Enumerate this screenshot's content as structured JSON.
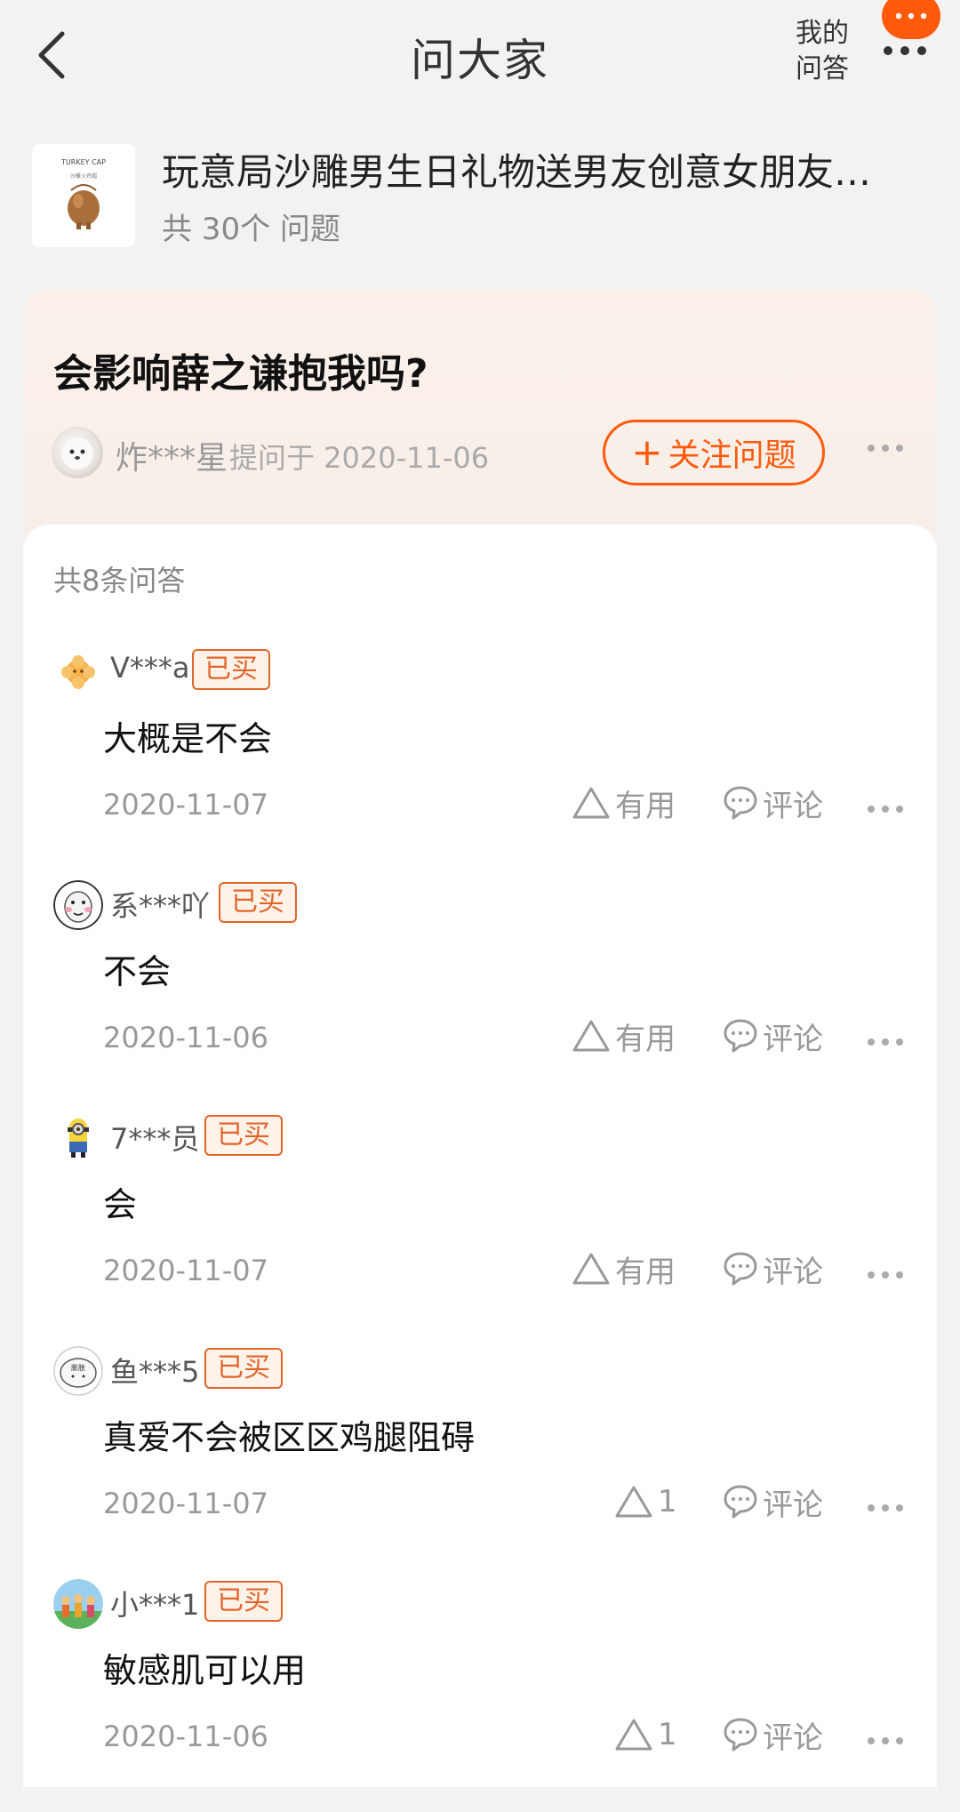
{
  "header": {
    "title": "问大家",
    "my_qa_line1": "我的",
    "my_qa_line2": "问答",
    "back_icon": "chevron-left-icon",
    "more_icon": "more-icon",
    "accent": "#ff5a0c"
  },
  "product": {
    "thumb_text": "TURKEY CAP",
    "name": "玩意局沙雕男生日礼物送男友创意女朋友…",
    "count": "共 30个 问题"
  },
  "question": {
    "text": "会影响薛之谦抱我吗?",
    "asker": "炸***星",
    "asked_at": "提问于 2020-11-06",
    "follow_label": "关注问题"
  },
  "answers_section": {
    "count_label": "共8条问答",
    "useful_label": "有用",
    "comment_label": "评论",
    "bought_label": "已买",
    "items": [
      {
        "user": "V***a",
        "text": "大概是不会",
        "date": "2020-11-07",
        "useful": "有用"
      },
      {
        "user": "系***吖",
        "text": "不会",
        "date": "2020-11-06",
        "useful": "有用"
      },
      {
        "user": "7***员",
        "text": "会",
        "date": "2020-11-07",
        "useful": "有用"
      },
      {
        "user": "鱼***5",
        "text": "真爱不会被区区鸡腿阻碍",
        "date": "2020-11-07",
        "useful": "1"
      },
      {
        "user": "小***1",
        "text": "敏感肌可以用",
        "date": "2020-11-06",
        "useful": "1"
      }
    ]
  }
}
